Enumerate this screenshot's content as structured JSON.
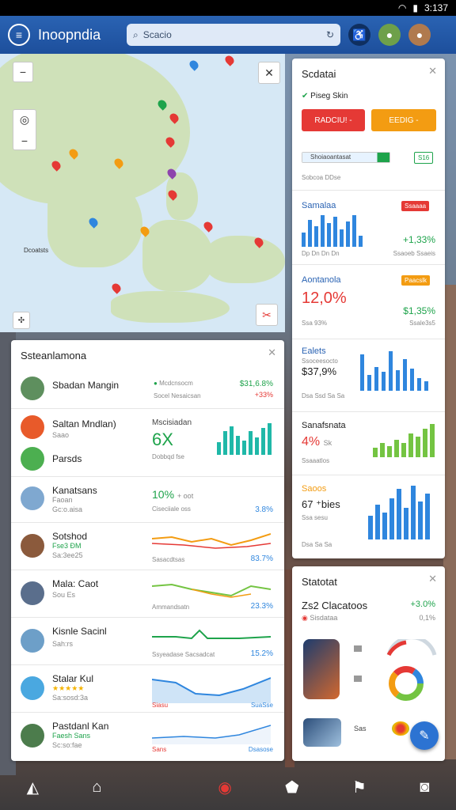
{
  "status": {
    "time": "3:137"
  },
  "appbar": {
    "title": "Inoopndia",
    "search_placeholder": "Scacio"
  },
  "map": {
    "label": "Dcoatsts"
  },
  "right_card": {
    "title": "Scdatai",
    "subtitle": "Piseg Skin",
    "btn_red": "RADCIU! -",
    "btn_orange": "EEDIG -",
    "progress_label": "Shoiaoantasat",
    "progress_value": "S16",
    "progress_sub": "Sobcoa DDse",
    "sections": [
      {
        "title": "Samalaa",
        "tag": "Ssaaaa",
        "pct": "+1,33%",
        "foot": "Dp Dn Dn Dn",
        "foot2": "Ssaoeb Ssaeis"
      },
      {
        "title": "Aontanola",
        "tag": "Paacslk",
        "big": "12,0%",
        "sub": "Ssa 93%",
        "pct": "$1,35%",
        "sub2": "Ssale3s5"
      },
      {
        "title": "Ealets",
        "sub": "Ssoceesocto",
        "big": "$37,9%",
        "foot": "Dsa Ssd Sa Sa"
      },
      {
        "title": "Sanafsnata",
        "big": "4%",
        "big_sfx": "Sk",
        "sub": "Ssaaatlos"
      },
      {
        "title": "Saoos",
        "big": "67 ⁺bies",
        "sub": "Ssa sesu",
        "foot": "Dsa Sa Sa"
      }
    ]
  },
  "left_card": {
    "title": "Ssteanlamona",
    "rows": [
      {
        "title": "Sbadan Mangin",
        "sub": "",
        "chip": "Mcdcnsocm",
        "chip2": "Socel Nesaicsan",
        "val": "$31,6.8%",
        "val2": "+33%"
      },
      {
        "title": "Saltan Mndlan)",
        "sub": "Saao",
        "chip": "Mscisiadan",
        "big": "6X",
        "sub2": "Dobbqd fse"
      },
      {
        "title": "Parsds"
      },
      {
        "title": "Kanatsans",
        "sub": "Faoan",
        "sub_b": "Gc:o.aisa",
        "big": "10%",
        "big_sfx": "+ oot",
        "sub2": "Ciseciiale oss",
        "val": "3.8%"
      },
      {
        "title": "Sotshod",
        "sub": "Fse3 ĐM",
        "sub_b": "Sa:3ee25",
        "sub2": "Sasacdtsas",
        "val": "83.7%"
      },
      {
        "title": "Mala: Caot",
        "sub": "Sou Es",
        "sub2": "Ammandsatn",
        "val": "23.3%"
      },
      {
        "title": "Kisnle Sacinl",
        "sub": "Sah:rs",
        "sub2": "Ssyeadase Sacsadcat",
        "val": "15.2%"
      },
      {
        "title": "Stalar Kul",
        "sub": "★★★★★",
        "sub_b": "Sa:sosd:3a",
        "sub2": "Siasu",
        "val": "SuaSse"
      },
      {
        "title": "Pastdanl Kan",
        "sub": "Faesh Sans",
        "sub_b": "Sc:so:fae",
        "sub2": "Sans",
        "val": "Dsasose"
      }
    ]
  },
  "stat_card": {
    "title": "Statotat",
    "headline": "Zs2 Clacatoos",
    "sub": "Sisdataa",
    "pct": "+3.0%",
    "pct2": "0,1%",
    "thumb_label": "Sas"
  },
  "nav": {
    "items": [
      "home",
      "map",
      "record",
      "shield",
      "flag",
      "profile"
    ]
  },
  "colors": {
    "primary": "#2a63b3",
    "green": "#1ea34b",
    "red": "#e53935",
    "orange": "#f39c12",
    "blue_bar": "#2f86de"
  }
}
